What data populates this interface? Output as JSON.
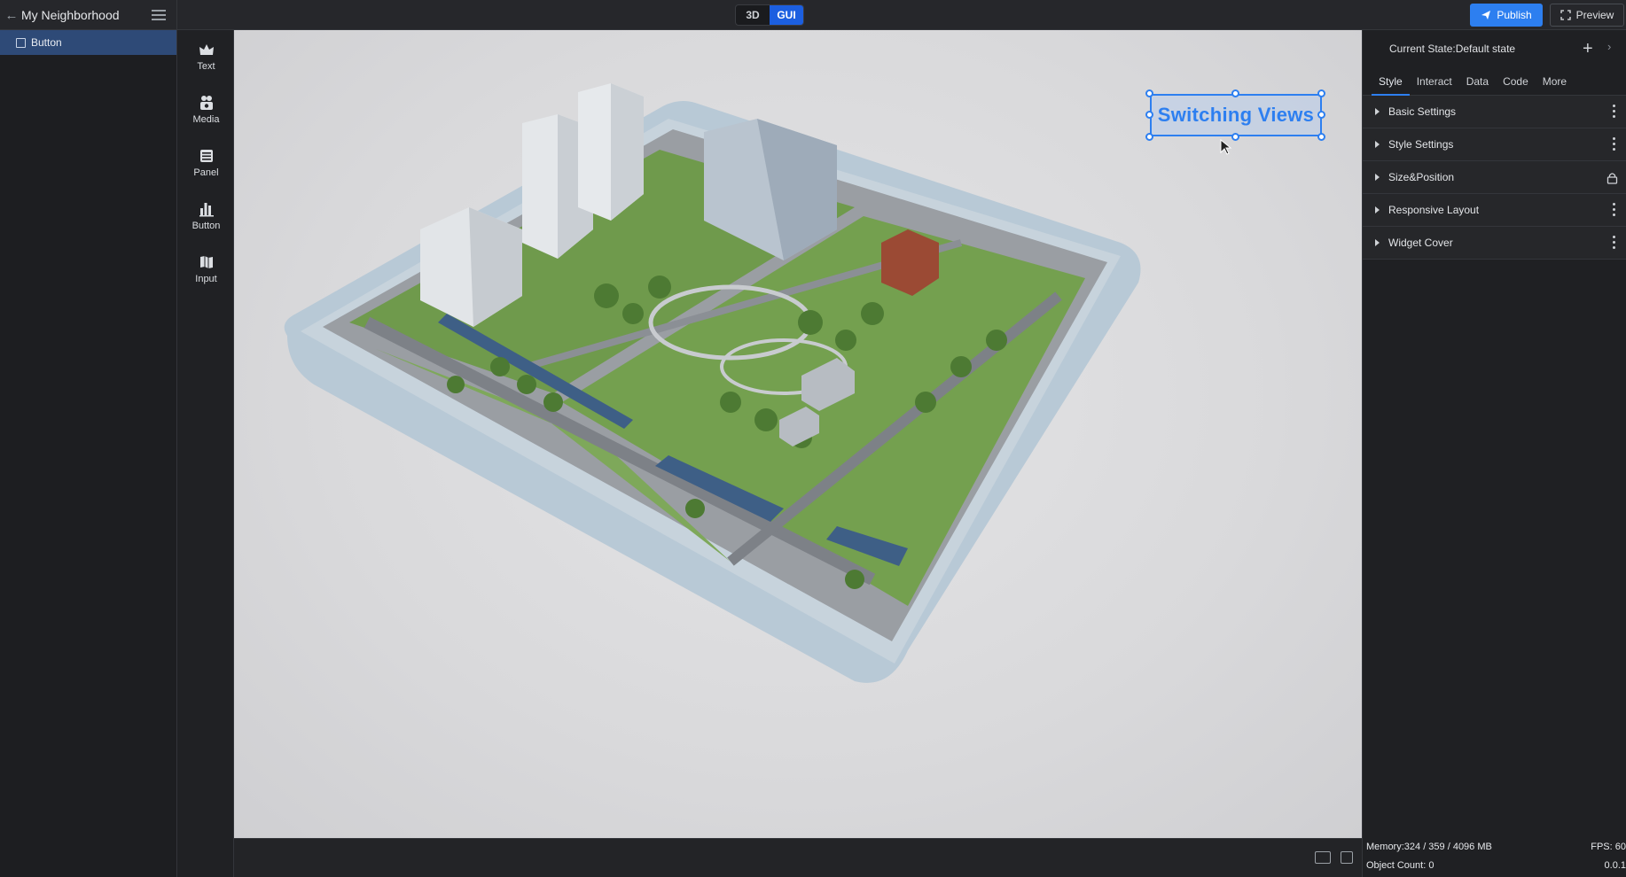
{
  "header": {
    "project_name": "My Neighborhood",
    "mode_3d": "3D",
    "mode_gui": "GUI",
    "publish_label": "Publish",
    "preview_label": "Preview"
  },
  "layers": {
    "items": [
      {
        "label": "Button"
      }
    ]
  },
  "widgets": [
    {
      "label": "Text",
      "icon": "text-widget-icon"
    },
    {
      "label": "Media",
      "icon": "media-widget-icon"
    },
    {
      "label": "Panel",
      "icon": "panel-widget-icon"
    },
    {
      "label": "Button",
      "icon": "button-widget-icon"
    },
    {
      "label": "Input",
      "icon": "input-widget-icon"
    }
  ],
  "canvas": {
    "selected_widget_text": "Switching Views"
  },
  "inspector": {
    "current_state": "Current State:Default state",
    "tabs": [
      "Style",
      "Interact",
      "Data",
      "Code",
      "More"
    ],
    "active_tab": "Style",
    "sections": [
      {
        "label": "Basic Settings",
        "action": "more-icon"
      },
      {
        "label": "Style Settings",
        "action": "more-icon"
      },
      {
        "label": "Size&Position",
        "action": "lock-icon"
      },
      {
        "label": "Responsive Layout",
        "action": "more-icon"
      },
      {
        "label": "Widget Cover",
        "action": "more-icon"
      }
    ]
  },
  "status": {
    "memory": "Memory:324 / 359 / 4096 MB",
    "fps": "FPS: 60",
    "object_count": "Object Count: 0",
    "version": "0.0.1"
  },
  "colors": {
    "accent": "#2d7ff0",
    "gui_toggle_active": "#1c5fe0",
    "layer_selected": "#2e4a77"
  }
}
